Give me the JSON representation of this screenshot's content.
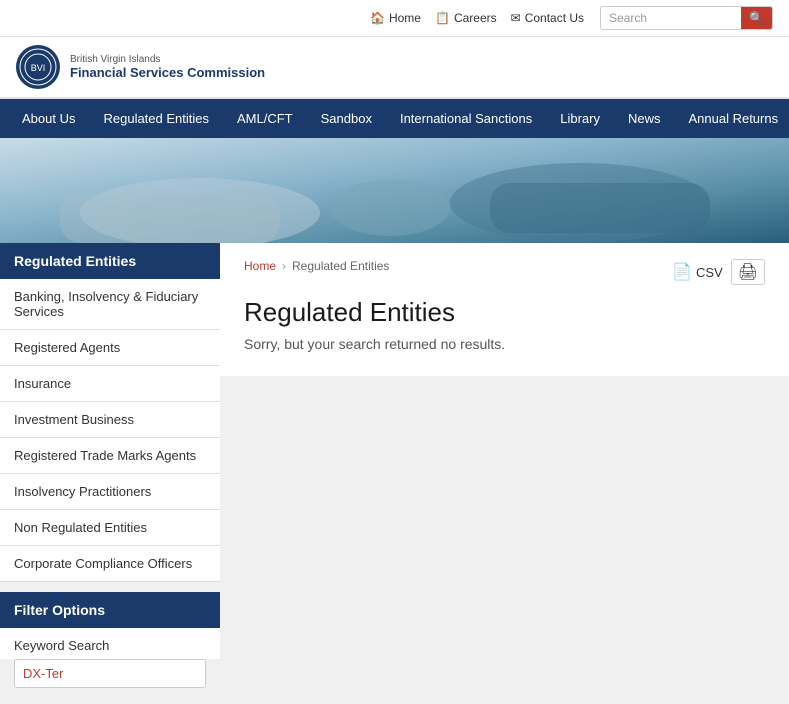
{
  "topbar": {
    "links": [
      {
        "label": "Home",
        "icon": "home-icon"
      },
      {
        "label": "Careers",
        "icon": "careers-icon"
      },
      {
        "label": "Contact Us",
        "icon": "contact-icon"
      }
    ],
    "search_placeholder": "Search"
  },
  "header": {
    "bvi_label": "British Virgin Islands",
    "org_name": "Financial Services Commission"
  },
  "nav": {
    "items": [
      {
        "label": "About Us"
      },
      {
        "label": "Regulated Entities"
      },
      {
        "label": "AML/CFT"
      },
      {
        "label": "Sandbox"
      },
      {
        "label": "International Sanctions"
      },
      {
        "label": "Library"
      },
      {
        "label": "News"
      },
      {
        "label": "Annual Returns"
      }
    ]
  },
  "sidebar": {
    "section_title": "Regulated Entities",
    "items": [
      {
        "label": "Banking, Insolvency & Fiduciary Services"
      },
      {
        "label": "Registered Agents"
      },
      {
        "label": "Insurance"
      },
      {
        "label": "Investment Business"
      },
      {
        "label": "Registered Trade Marks Agents"
      },
      {
        "label": "Insolvency Practitioners"
      },
      {
        "label": "Non Regulated Entities"
      },
      {
        "label": "Corporate Compliance Officers"
      }
    ],
    "filter_title": "Filter Options",
    "keyword_label": "Keyword Search",
    "keyword_value": "DX-Ter"
  },
  "main": {
    "breadcrumb_home": "Home",
    "breadcrumb_current": "Regulated Entities",
    "page_title": "Regulated Entities",
    "no_results_message": "Sorry, but your search returned no results.",
    "csv_label": "CSV"
  }
}
